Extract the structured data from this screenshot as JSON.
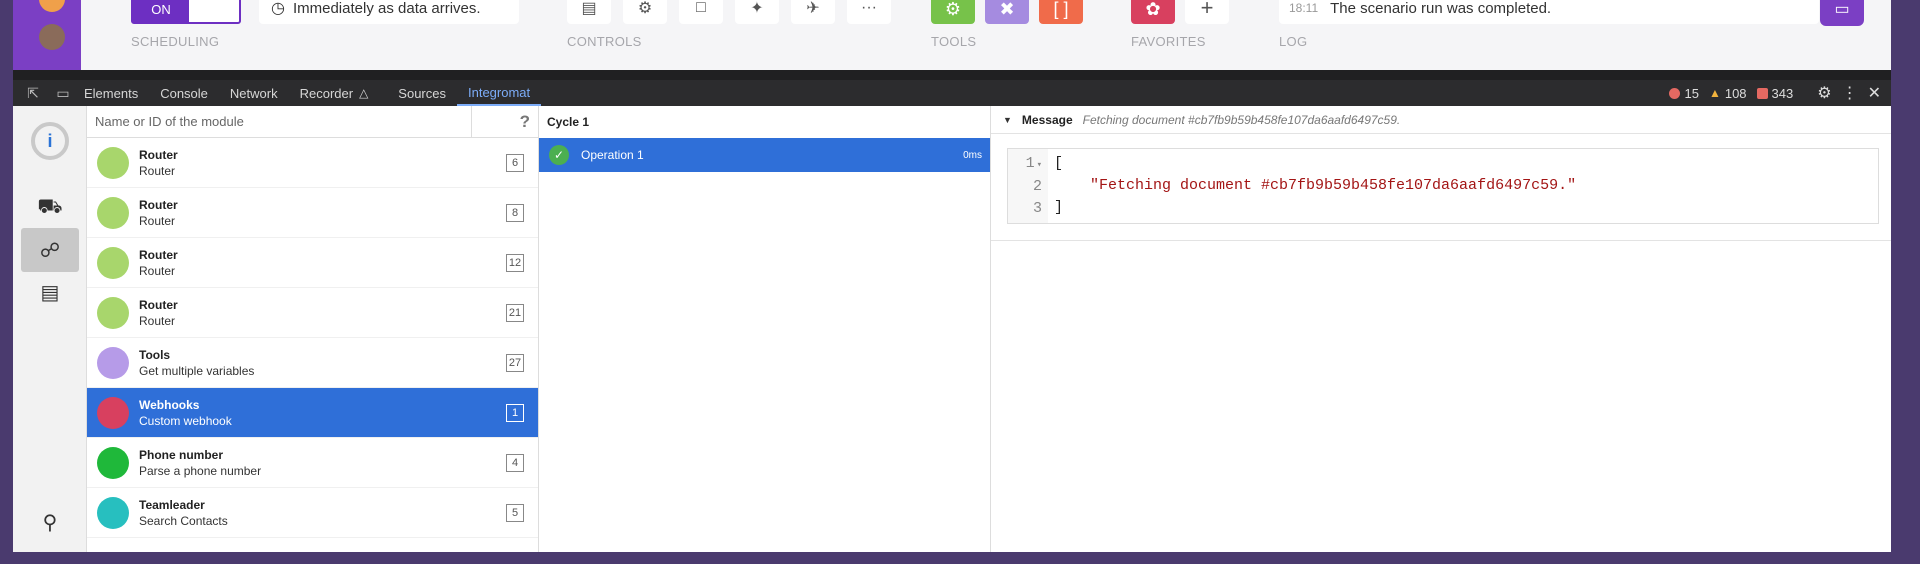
{
  "app": {
    "toggle_label": "ON",
    "scheduling_text": "Immediately as data arrives.",
    "groups": {
      "scheduling": "SCHEDULING",
      "controls": "CONTROLS",
      "tools": "TOOLS",
      "favorites": "FAVORITES",
      "log": "LOG"
    },
    "log": {
      "time": "18:11",
      "message": "The scenario run was completed."
    },
    "colors": {
      "brand": "#7b3fc4",
      "tools_green": "#77c24a",
      "tools_purple": "#a58be0",
      "tools_orange": "#f06b4a",
      "webhooks": "#d8405f"
    }
  },
  "devtools": {
    "tabs": [
      "Elements",
      "Console",
      "Network",
      "Recorder",
      "Sources",
      "Integromat"
    ],
    "active_tab": "Integromat",
    "counts": {
      "errors": "15",
      "warnings": "108",
      "issues": "343"
    }
  },
  "modules": {
    "search_placeholder": "Name or ID of the module",
    "help": "?",
    "items": [
      {
        "name": "Router",
        "sub": "Router",
        "id": "6",
        "color": "#a8d66c"
      },
      {
        "name": "Router",
        "sub": "Router",
        "id": "8",
        "color": "#a8d66c"
      },
      {
        "name": "Router",
        "sub": "Router",
        "id": "12",
        "color": "#a8d66c"
      },
      {
        "name": "Router",
        "sub": "Router",
        "id": "21",
        "color": "#a8d66c"
      },
      {
        "name": "Tools",
        "sub": "Get multiple variables",
        "id": "27",
        "color": "#b69be8"
      },
      {
        "name": "Webhooks",
        "sub": "Custom webhook",
        "id": "1",
        "color": "#d8405f"
      },
      {
        "name": "Phone number",
        "sub": "Parse a phone number",
        "id": "4",
        "color": "#1fb83a"
      },
      {
        "name": "Teamleader",
        "sub": "Search Contacts",
        "id": "5",
        "color": "#27bfbf"
      }
    ],
    "selected_index": 5
  },
  "cycle": {
    "title": "Cycle 1",
    "operation": "Operation 1",
    "time": "0ms"
  },
  "message": {
    "title": "Message",
    "preview": "Fetching document #cb7fb9b59b458fe107da6aafd6497c59.",
    "lines": [
      "1",
      "2",
      "3"
    ],
    "open": "[",
    "value": "\"Fetching document #cb7fb9b59b458fe107da6aafd6497c59.\"",
    "close": "]"
  }
}
